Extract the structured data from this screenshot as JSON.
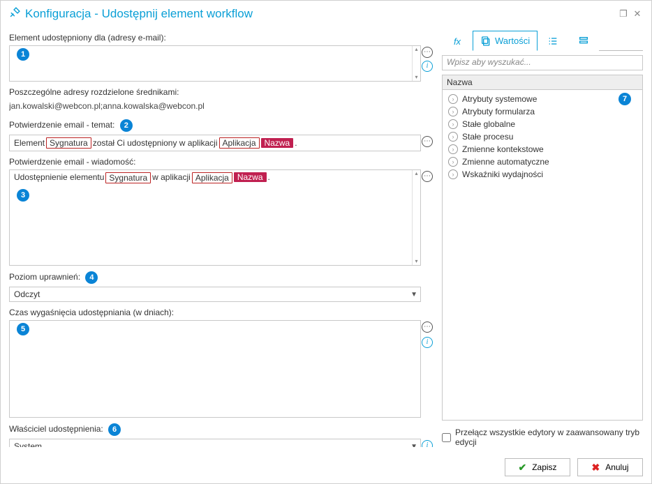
{
  "window": {
    "title": "Konfiguracja - Udostępnij element workflow"
  },
  "left": {
    "shared_for_label": "Element udostępniony dla (adresy e-mail):",
    "sep_label": "Poszczególne adresy rozdzielone średnikami:",
    "sep_example": "jan.kowalski@webcon.pl;anna.kowalska@webcon.pl",
    "subject_label": "Potwierdzenie email - temat:",
    "subject_parts": {
      "p1": "Element",
      "tag1": "Sygnatura",
      "p2": "został Ci udostępniony w aplikacji",
      "tag2a": "Aplikacja",
      "tag2b": "Nazwa",
      "p3": "."
    },
    "message_label": "Potwierdzenie email - wiadomość:",
    "message_parts": {
      "p1": "Udostępnienie elementu",
      "tag1": "Sygnatura",
      "p2": "w aplikacji",
      "tag2a": "Aplikacja",
      "tag2b": "Nazwa",
      "p3": "."
    },
    "perm_label": "Poziom uprawnień:",
    "perm_value": "Odczyt",
    "expire_label": "Czas wygaśnięcia udostępniania (w dniach):",
    "owner_label": "Właściciel udostępnienia:",
    "owner_value": "System"
  },
  "badges": {
    "b1": "1",
    "b2": "2",
    "b3": "3",
    "b4": "4",
    "b5": "5",
    "b6": "6",
    "b7": "7"
  },
  "right": {
    "tab_values": "Wartości",
    "search_placeholder": "Wpisz aby wyszukać...",
    "tree_header": "Nazwa",
    "items": [
      "Atrybuty systemowe",
      "Atrybuty formularza",
      "Stałe globalne",
      "Stałe procesu",
      "Zmienne kontekstowe",
      "Zmienne automatyczne",
      "Wskaźniki wydajności"
    ],
    "advanced_label": "Przełącz wszystkie edytory w zaawansowany tryb edycji"
  },
  "footer": {
    "save": "Zapisz",
    "cancel": "Anuluj"
  }
}
